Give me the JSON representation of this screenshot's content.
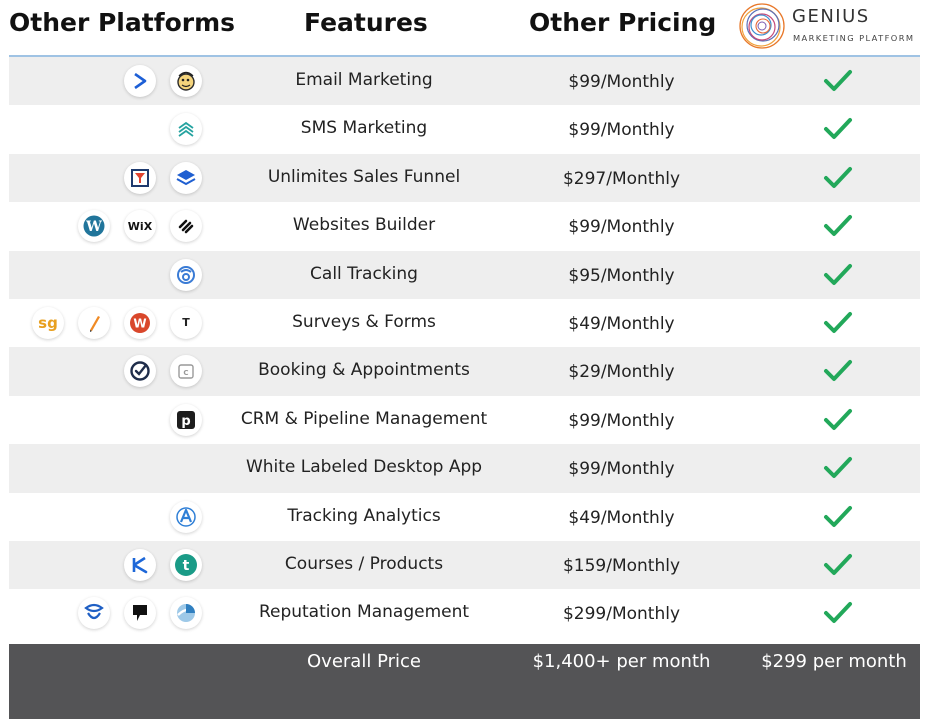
{
  "header": {
    "platforms_label": "Other Platforms",
    "features_label": "Features",
    "pricing_label": "Other Pricing",
    "logo_word": "GENIUS",
    "logo_sub": "MARKETING PLATFORM"
  },
  "rows": [
    {
      "feature": "Email Marketing",
      "price": "$99/Monthly",
      "icons": [
        "activecampaign-icon",
        "mailchimp-icon"
      ]
    },
    {
      "feature": "SMS Marketing",
      "price": "$99/Monthly",
      "icons": [
        "sms-chevrons-icon"
      ]
    },
    {
      "feature": "Unlimites Sales Funnel",
      "price": "$297/Monthly",
      "icons": [
        "clickfunnels-icon",
        "leadpages-layers-icon"
      ]
    },
    {
      "feature": "Websites Builder",
      "price": "$99/Monthly",
      "icons": [
        "wordpress-icon",
        "wix-icon",
        "squarespace-icon"
      ]
    },
    {
      "feature": "Call Tracking",
      "price": "$95/Monthly",
      "icons": [
        "calltracking-icon"
      ]
    },
    {
      "feature": "Surveys & Forms",
      "price": "$49/Monthly",
      "icons": [
        "surveygizmo-icon",
        "jotform-pencil-icon",
        "wufoo-icon",
        "typeform-icon"
      ]
    },
    {
      "feature": "Booking & Appointments",
      "price": "$29/Monthly",
      "icons": [
        "acuity-check-icon",
        "calendly-icon"
      ]
    },
    {
      "feature": "CRM & Pipeline Management",
      "price": "$99/Monthly",
      "icons": [
        "pipedrive-icon"
      ]
    },
    {
      "feature": "White Labeled Desktop App",
      "price": "$99/Monthly",
      "icons": []
    },
    {
      "feature": "Tracking Analytics",
      "price": "$49/Monthly",
      "icons": [
        "analytics-a-icon"
      ]
    },
    {
      "feature": "Courses / Products",
      "price": "$159/Monthly",
      "icons": [
        "kajabi-icon",
        "teachable-icon"
      ]
    },
    {
      "feature": "Reputation Management",
      "price": "$299/Monthly",
      "icons": [
        "birdeye-icon",
        "podium-icon",
        "reputation-icon"
      ]
    }
  ],
  "footer": {
    "label": "Overall Price",
    "other_total": "$1,400+ per month",
    "genius_total": "$299 per month"
  },
  "colors": {
    "check_green": "#22a85a",
    "footer_bg": "#545456",
    "row_shade": "#eeeeee",
    "header_line": "#9fc3e4"
  }
}
